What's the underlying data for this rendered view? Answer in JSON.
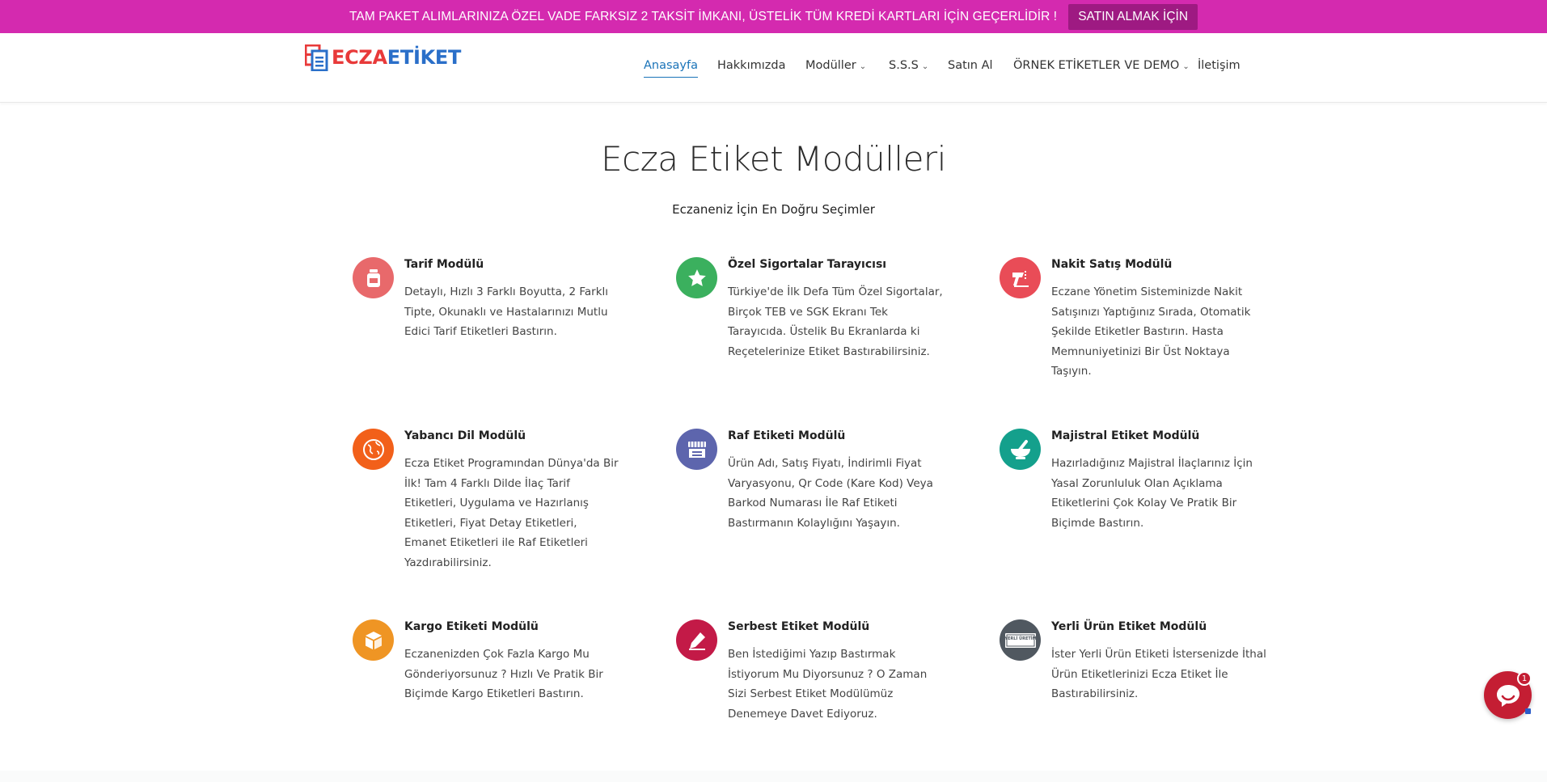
{
  "promo": {
    "text": "TAM PAKET ALIMLARINIZA ÖZEL VADE FARKSIZ 2 TAKSİT İMKANI, ÜSTELİK TÜM KREDİ KARTLARI İÇİN GEÇERLİDİR !",
    "button_label": "SATIN ALMAK İÇİN",
    "bg_color": "#d42aaf"
  },
  "logo": {
    "part1": "ECZA",
    "part2": "ETİKET"
  },
  "nav": {
    "items": [
      {
        "label": "Anasayfa",
        "active": true,
        "dropdown": false
      },
      {
        "label": "Hakkımızda",
        "active": false,
        "dropdown": false
      },
      {
        "label": "Modüller",
        "active": false,
        "dropdown": true
      },
      {
        "label": "S.S.S",
        "active": false,
        "dropdown": true
      },
      {
        "label": "Satın Al",
        "active": false,
        "dropdown": false
      },
      {
        "label": "ÖRNEK ETİKETLER VE DEMO",
        "active": false,
        "dropdown": true
      },
      {
        "label": "İletişim",
        "active": false,
        "dropdown": false
      }
    ],
    "caret": "⌄"
  },
  "main": {
    "title": "Ecza Etiket Modülleri",
    "subtitle": "Eczaneniz İçin En Doğru Seçimler",
    "features": [
      {
        "title": "Tarif Modülü",
        "description": "Detaylı, Hızlı 3 Farklı Boyutta, 2 Farklı Tipte, Okunaklı ve Hastalarınızı Mutlu Edici Tarif Etiketleri Bastırın.",
        "icon": "medicine-bottle-icon",
        "color": "#e8696b"
      },
      {
        "title": "Özel Sigortalar Tarayıcısı",
        "description": "Türkiye'de İlk Defa Tüm Özel Sigortalar, Birçok TEB ve SGK Ekranı Tek Tarayıcıda. Üstelik Bu Ekranlarda ki Reçetelerinize Etiket Bastırabilirsiniz.",
        "icon": "star-icon",
        "color": "#3bb05e"
      },
      {
        "title": "Nakit Satış Modülü",
        "description": "Eczane Yönetim Sisteminizde Nakit Satışınızı Yaptığınız Sırada, Otomatik Şekilde Etiketler Bastırın. Hasta Memnuniyetinizi Bir Üst Noktaya Taşıyın.",
        "icon": "label-gun-icon",
        "color": "#e94c57"
      },
      {
        "title": "Yabancı Dil Modülü",
        "description": "Ecza Etiket Programından Dünya'da Bir İlk! Tam 4 Farklı Dilde İlaç Tarif Etiketleri, Uygulama ve Hazırlanış Etiketleri, Fiyat Detay Etiketleri, Emanet Etiketleri ile Raf Etiketleri Yazdırabilirsiniz.",
        "icon": "globe-icon",
        "color": "#f2601a"
      },
      {
        "title": "Raf Etiketi Modülü",
        "description": "Ürün Adı, Satış Fiyatı, İndirimli Fiyat Varyasyonu, Qr Code (Kare Kod) Veya Barkod Numarası İle Raf Etiketi Bastırmanın Kolaylığını Yaşayın.",
        "icon": "shop-shelf-icon",
        "color": "#5d65ad"
      },
      {
        "title": "Majistral Etiket Modülü",
        "description": "Hazırladığınız Majistral İlaçlarınız İçin Yasal Zorunluluk Olan Açıklama Etiketlerini Çok Kolay Ve Pratik Bir Biçimde Bastırın.",
        "icon": "mortar-pestle-icon",
        "color": "#14a08c"
      },
      {
        "title": "Kargo Etiketi Modülü",
        "description": "Eczanenizden Çok Fazla Kargo Mu Gönderiyorsunuz ? Hızlı Ve Pratik Bir Biçimde Kargo Etiketleri Bastırın.",
        "icon": "package-box-icon",
        "color": "#ef9524"
      },
      {
        "title": "Serbest Etiket Modülü",
        "description": "Ben İstediğimi Yazıp Bastırmak İstiyorum Mu Diyorsunuz ? O Zaman Sizi Serbest Etiket Modülümüz Denemeye Davet Ediyoruz.",
        "icon": "pencil-icon",
        "color": "#c31a47"
      },
      {
        "title": "Yerli Ürün Etiket Modülü",
        "description": "İster Yerli Ürün Etiketi İstersenizde İthal Ürün Etiketlerinizi Ecza Etiket İle Bastırabilirsiniz.",
        "icon": "local-product-badge-icon",
        "color": "#505860",
        "badge_text": "YERLİ ÜRETİM"
      }
    ]
  },
  "chat": {
    "badge_count": "1",
    "icon": "chat-bubble-icon",
    "color": "#c41e33"
  }
}
